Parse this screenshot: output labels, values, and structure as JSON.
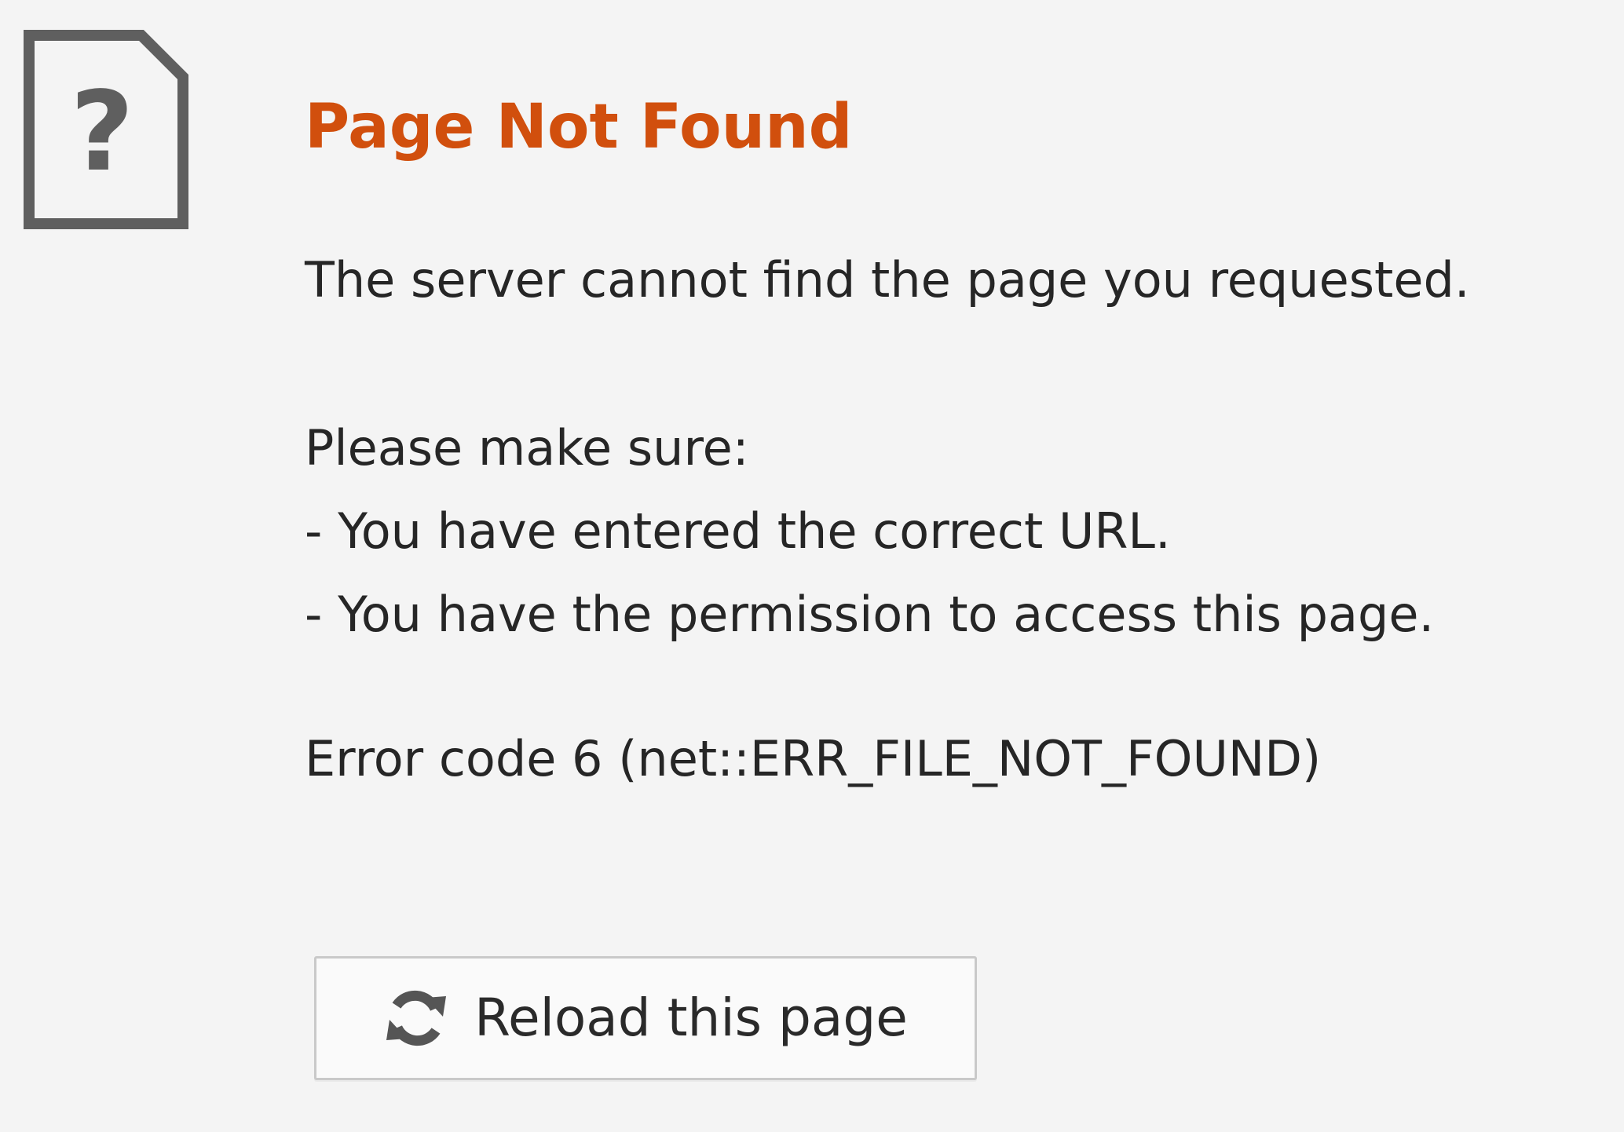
{
  "error": {
    "title": "Page Not Found",
    "summary": "The server cannot find the page you requested.",
    "checklist_intro": "Please make sure:",
    "checklist": [
      "- You have entered the correct URL.",
      "- You have the permission to access this page."
    ],
    "error_code_text": "Error code 6 (net::ERR_FILE_NOT_FOUND)"
  },
  "reload_button": {
    "label": "Reload this page",
    "icon": "reload-icon"
  },
  "icons": {
    "main": "missing-document-icon"
  },
  "colors": {
    "background": "#f4f4f4",
    "title": "#d14f0d",
    "text": "#262626",
    "icon": "#5f5f5f",
    "button_border": "#c9c9c9",
    "button_background": "#fafafa"
  }
}
